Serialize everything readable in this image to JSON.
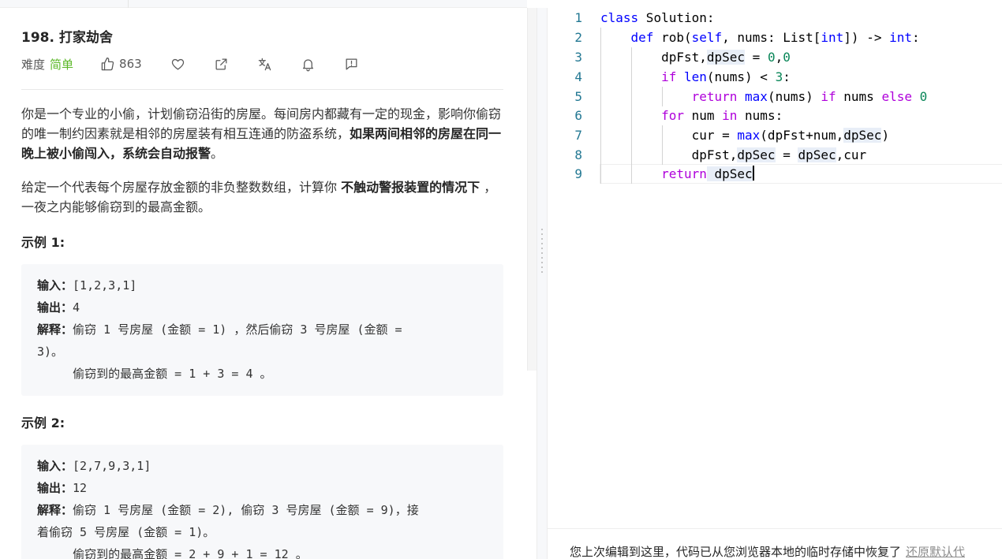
{
  "problem": {
    "title": "198. 打家劫舍",
    "difficulty_label": "难度",
    "difficulty": "简单",
    "likes": "863",
    "icons": [
      "thumbs-up-icon",
      "heart-icon",
      "share-icon",
      "translate-icon",
      "bell-icon",
      "feedback-icon"
    ]
  },
  "description": {
    "p1_text": "你是一个专业的小偷，计划偷窃沿街的房屋。每间房内都藏有一定的现金，影响你偷窃的唯一制约因素就是相邻的房屋装有相互连通的防盗系统，",
    "p1_bold": "如果两间相邻的房屋在同一晚上被小偷闯入，系统会自动报警",
    "p1_end": "。",
    "p2_text": "给定一个代表每个房屋存放金额的非负整数数组，计算你 ",
    "p2_bold": "不触动警报装置的情况下",
    "p2_end": " ，一夜之内能够偷窃到的最高金额。"
  },
  "examples": [
    {
      "title": "示例 1:",
      "input_label": "输入：",
      "input": "[1,2,3,1]",
      "output_label": "输出：",
      "output": "4",
      "explain_label": "解释：",
      "explain_1": "偷窃 1 号房屋 (金额 = 1) ，然后偷窃 3 号房屋 (金额 =",
      "explain_2": "3)。",
      "explain_3": "     偷窃到的最高金额 = 1 + 3 = 4 。"
    },
    {
      "title": "示例 2:",
      "input_label": "输入：",
      "input": "[2,7,9,3,1]",
      "output_label": "输出：",
      "output": "12",
      "explain_label": "解释：",
      "explain_1": "偷窃 1 号房屋 (金额 = 2), 偷窃 3 号房屋 (金额 = 9)，接",
      "explain_2": "着偷窃 5 号房屋 (金额 = 1)。",
      "explain_3": "     偷窃到的最高金额 = 2 + 9 + 1 = 12 。"
    }
  ],
  "editor": {
    "line_numbers": [
      "1",
      "2",
      "3",
      "4",
      "5",
      "6",
      "7",
      "8",
      "9"
    ],
    "tokens": {
      "class": "class",
      "solution": " Solution:",
      "def": "def",
      "rob": "rob",
      "rob_paren": "(",
      "self": "self",
      "rob_args": ", nums: List[",
      "int1": "int",
      "rob_mid": "]) -> ",
      "int2": "int",
      "rob_end": ":",
      "l3_a": "dpFst,",
      "l3_b": "dpSec",
      "l3_c": " = ",
      "zero1": "0",
      "comma": ",",
      "zero2": "0",
      "if": "if",
      "len": "len",
      "l4_a": "(nums) < ",
      "three": "3",
      "colon": ":",
      "return1": "return",
      "max1": "max",
      "l5_a": "(nums) ",
      "if2": "if",
      "l5_b": " nums ",
      "else": "else",
      "zero3": "0",
      "for": "for",
      "l6_a": " num ",
      "in": "in",
      "l6_b": " nums:",
      "l7_a": "cur = ",
      "max2": "max",
      "l7_b": "(dpFst+num,",
      "l7_c": "dpSec",
      "l7_d": ")",
      "l8_a": "dpFst,",
      "l8_b": "dpSec",
      "l8_c": " = ",
      "l8_d": "dpSec",
      "l8_e": ",cur",
      "return2": "return",
      "l9_a": " dpSec"
    }
  },
  "status": {
    "message": "您上次编辑到这里，代码已从您浏览器本地的临时存储中恢复了",
    "link": "还原默认代"
  }
}
